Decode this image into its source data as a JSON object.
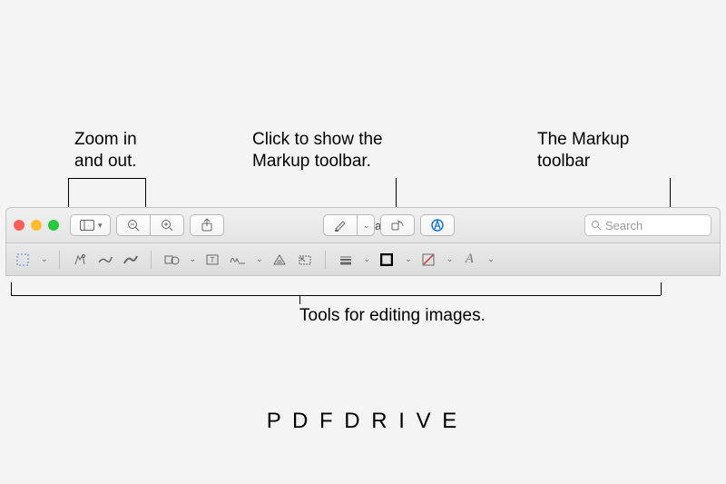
{
  "annotations": {
    "zoom": "Zoom in\nand out.",
    "markup_click": "Click to show the\nMarkup toolbar.",
    "markup_toolbar": "The Markup\ntoolbar",
    "editing_tools": "Tools for editing images."
  },
  "window": {
    "traffic_lights": [
      "#ff5f57",
      "#febc2e",
      "#28c840"
    ],
    "title": "Alaska",
    "search_placeholder": "Search"
  },
  "footer": "P D F D R I V E"
}
